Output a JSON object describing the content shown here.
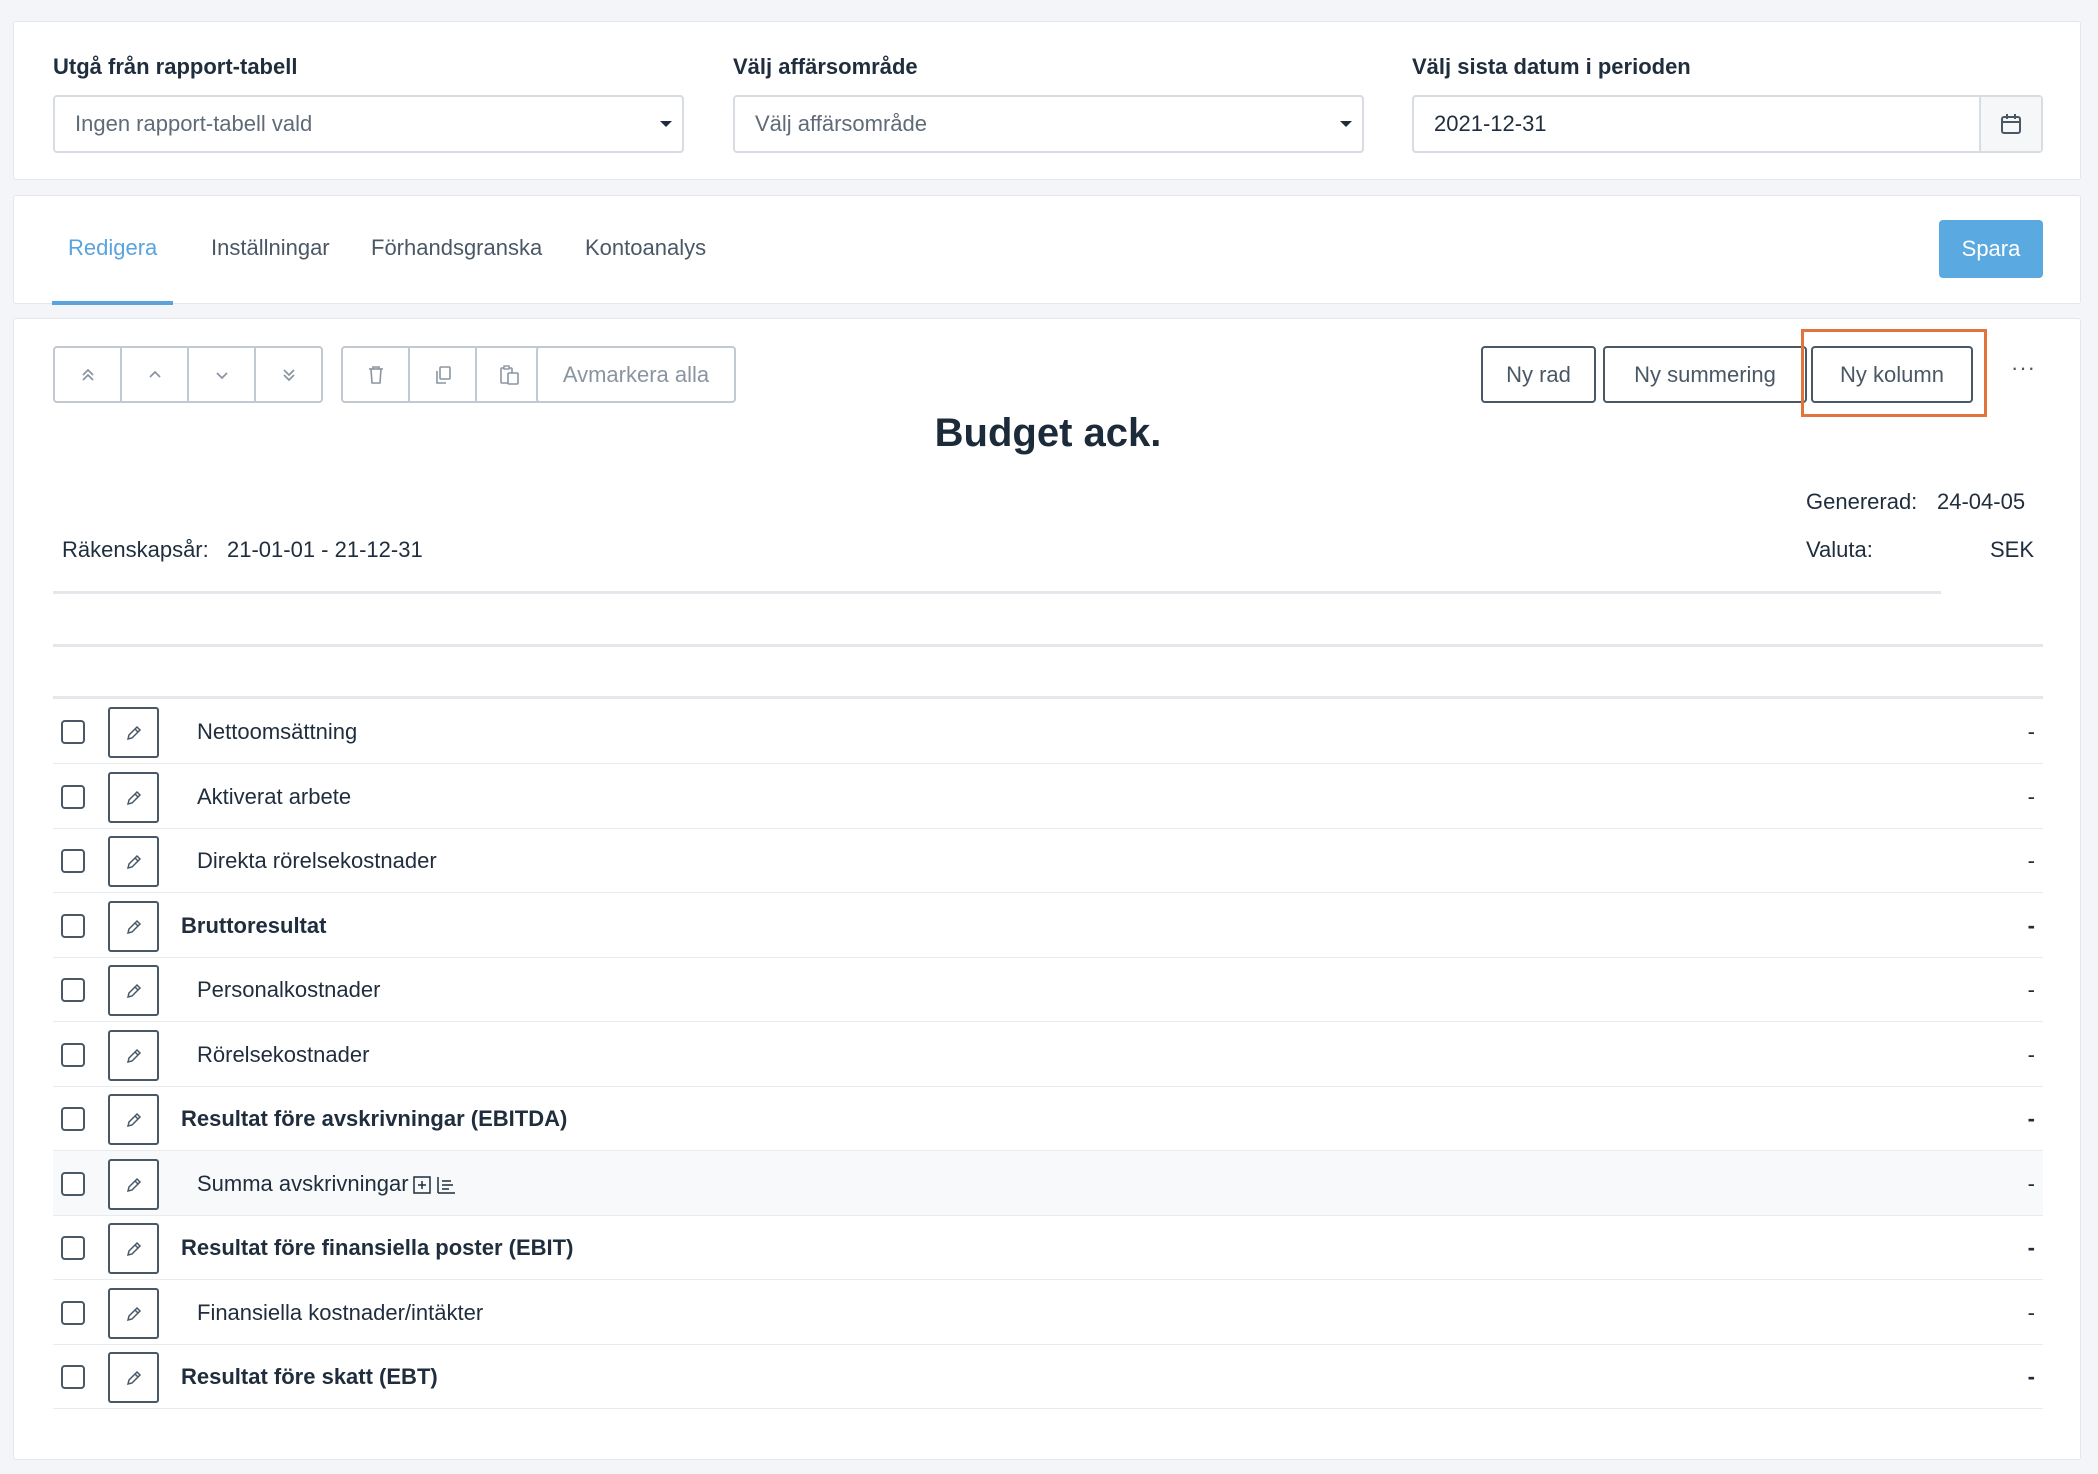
{
  "filters": {
    "report_table": {
      "label": "Utgå från rapport-tabell",
      "value": "Ingen rapport-tabell vald"
    },
    "business_area": {
      "label": "Välj affärsområde",
      "value": "Välj affärsområde"
    },
    "period_end": {
      "label": "Välj sista datum i perioden",
      "value": "2021-12-31"
    }
  },
  "tabs": [
    {
      "label": "Redigera",
      "active": true
    },
    {
      "label": "Inställningar",
      "active": false
    },
    {
      "label": "Förhandsgranska",
      "active": false
    },
    {
      "label": "Kontoanalys",
      "active": false
    }
  ],
  "save_label": "Spara",
  "toolbar": {
    "move_buttons": [
      "move-top-icon",
      "move-up-icon",
      "move-down-icon",
      "move-bottom-icon"
    ],
    "edit_buttons": [
      "delete-icon",
      "copy-icon",
      "paste-icon"
    ],
    "deselect_label": "Avmarkera alla",
    "new_row_label": "Ny rad",
    "new_sum_label": "Ny summering",
    "new_column_label": "Ny kolumn",
    "more_label": "···"
  },
  "report": {
    "title": "Budget ack.",
    "generated_label": "Genererad:",
    "generated_value": "24-04-05",
    "currency_label": "Valuta:",
    "currency_value": "SEK",
    "fiscal_label": "Räkenskapsår:",
    "fiscal_value": "21-01-01 - 21-12-31"
  },
  "rows": [
    {
      "label": "Nettoomsättning",
      "bold": false,
      "value": "-"
    },
    {
      "label": "Aktiverat arbete",
      "bold": false,
      "value": "-"
    },
    {
      "label": "Direkta rörelsekostnader",
      "bold": false,
      "value": "-"
    },
    {
      "label": "Bruttoresultat",
      "bold": true,
      "value": "-"
    },
    {
      "label": "Personalkostnader",
      "bold": false,
      "value": "-"
    },
    {
      "label": "Rörelsekostnader",
      "bold": false,
      "value": "-"
    },
    {
      "label": "Resultat före avskrivningar (EBITDA)",
      "bold": true,
      "value": "-"
    },
    {
      "label": "Summa avskrivningar",
      "bold": false,
      "value": "-",
      "highlight": true,
      "icons": [
        "expand-plus-icon",
        "list-detail-icon"
      ]
    },
    {
      "label": "Resultat före finansiella poster (EBIT)",
      "bold": true,
      "value": "-"
    },
    {
      "label": "Finansiella kostnader/intäkter",
      "bold": false,
      "value": "-"
    },
    {
      "label": "Resultat före skatt (EBT)",
      "bold": true,
      "value": "-"
    }
  ],
  "colors": {
    "accent": "#5aa3dd",
    "save_button": "#5aa9e0",
    "highlight_frame": "#e0743a"
  }
}
